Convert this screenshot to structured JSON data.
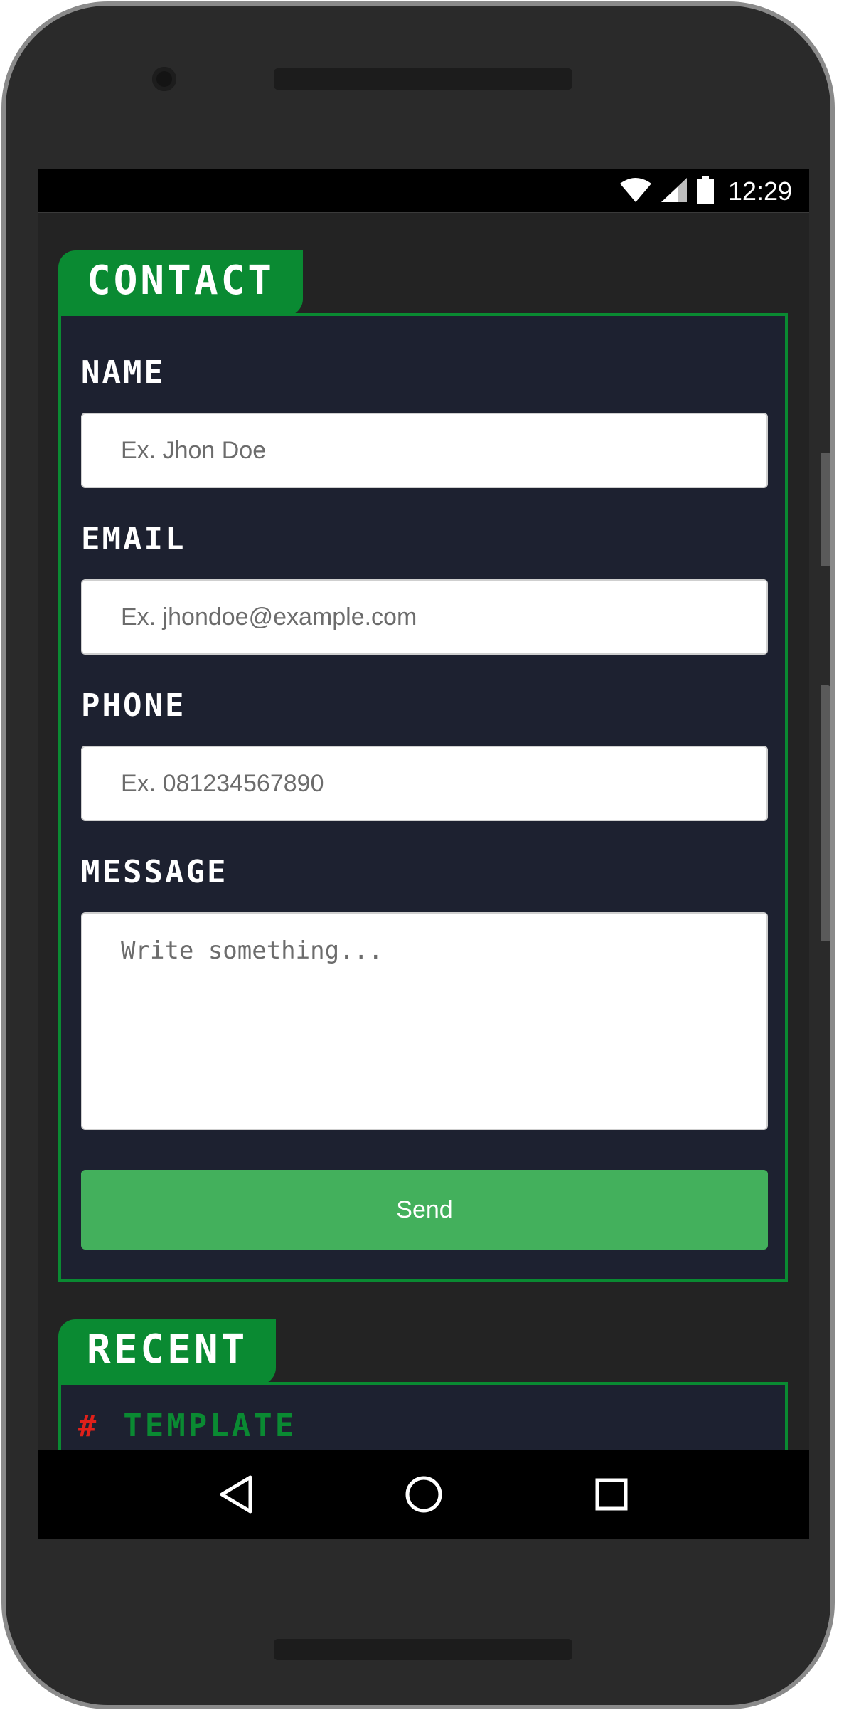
{
  "status_bar": {
    "time": "12:29",
    "icons": [
      "wifi-icon",
      "signal-icon",
      "battery-icon"
    ]
  },
  "contact": {
    "title": "Contact",
    "fields": {
      "name": {
        "label": "Name",
        "placeholder": "Ex. Jhon Doe"
      },
      "email": {
        "label": "Email",
        "placeholder": "Ex. jhondoe@example.com"
      },
      "phone": {
        "label": "Phone",
        "placeholder": "Ex. 081234567890"
      },
      "message": {
        "label": "Message",
        "placeholder": "Write something..."
      }
    },
    "send_label": "Send"
  },
  "recent": {
    "title": "Recent",
    "items": [
      {
        "icon": "#",
        "label": "Template"
      }
    ]
  },
  "nav": {
    "icons": [
      "back-icon",
      "home-icon",
      "recents-icon"
    ]
  },
  "colors": {
    "accent_green": "#0a8a32",
    "button_green": "#43b05c",
    "panel_bg": "#1d2130",
    "page_bg": "#232323",
    "hash_red": "#e0201a"
  }
}
